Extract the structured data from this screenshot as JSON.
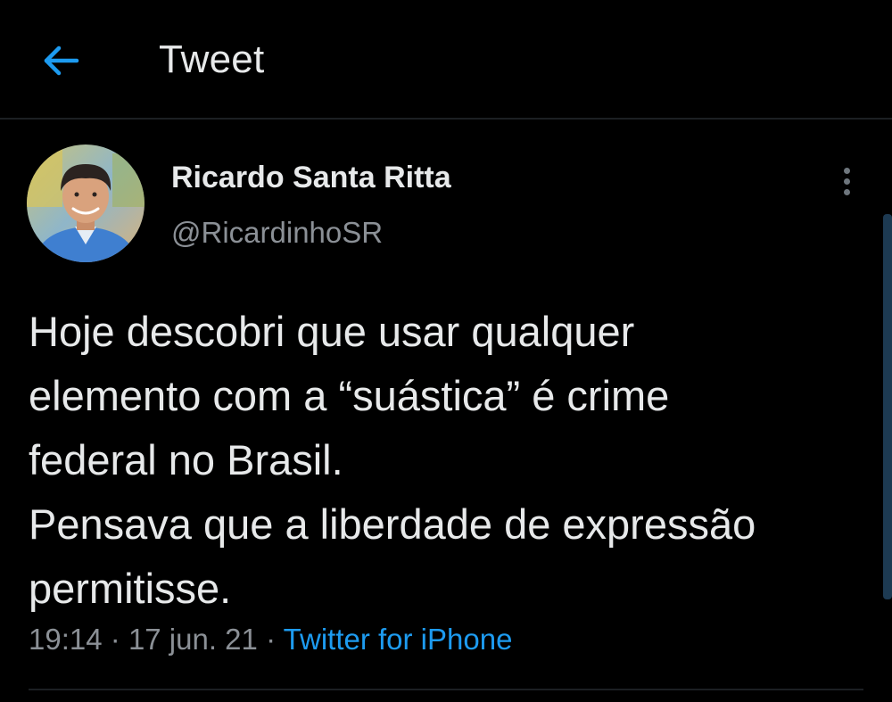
{
  "header": {
    "back_icon": "arrow-left-icon",
    "title": "Tweet"
  },
  "tweet": {
    "author": {
      "display_name": "Ricardo Santa Ritta",
      "handle": "@RicardinhoSR",
      "avatar_icon": "profile-photo"
    },
    "more_icon": "more-vertical-icon",
    "text": "Hoje descobri que usar qualquer\nelemento com a “suástica” é crime\nfederal no Brasil.\nPensava que a liberdade de expressão\npermitisse.",
    "time": "19:14",
    "date": "17 jun. 21",
    "separator": "·",
    "source": "Twitter for iPhone"
  },
  "colors": {
    "background": "#000000",
    "text_primary": "#e7e9ea",
    "text_secondary": "#8b9096",
    "accent": "#1d9bf0",
    "divider": "#1c1f23"
  }
}
